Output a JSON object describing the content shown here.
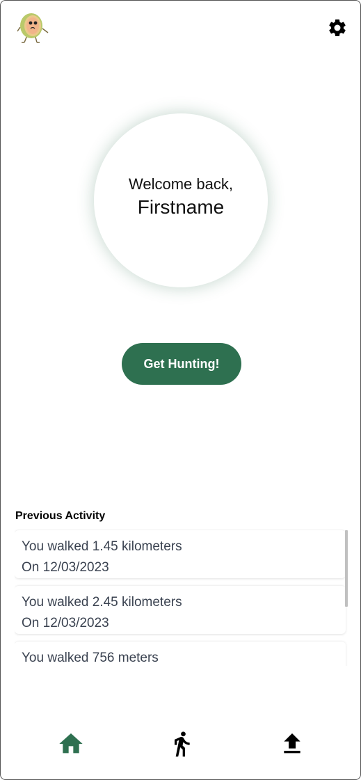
{
  "header": {
    "logo_icon": "melon-mascot-logo",
    "settings_icon": "gear-icon"
  },
  "welcome": {
    "greeting": "Welcome back,",
    "name": "Firstname"
  },
  "cta": {
    "label": "Get Hunting!",
    "color": "#2e7050"
  },
  "activity": {
    "title": "Previous Activity",
    "items": [
      {
        "line1": "You walked 1.45 kilometers",
        "line2": "On 12/03/2023"
      },
      {
        "line1": "You walked 2.45 kilometers",
        "line2": "On 12/03/2023"
      },
      {
        "line1": "You walked 756 meters",
        "line2": ""
      }
    ]
  },
  "nav": {
    "items": [
      {
        "icon": "home-icon",
        "active": true,
        "color": "#2e7050"
      },
      {
        "icon": "walking-icon",
        "active": false,
        "color": "#000000"
      },
      {
        "icon": "upload-icon",
        "active": false,
        "color": "#000000"
      }
    ]
  }
}
